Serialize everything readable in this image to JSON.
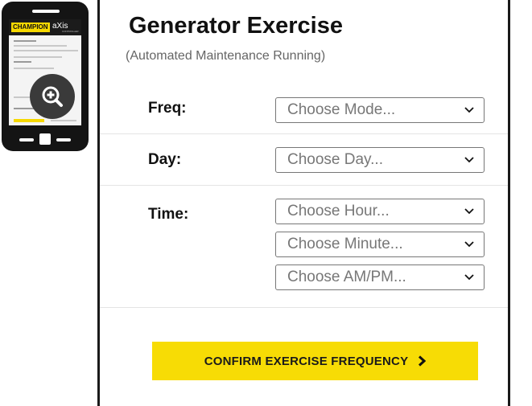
{
  "page": {
    "title": "Generator Exercise",
    "subtitle": "(Automated Maintenance Running)"
  },
  "thumbnail": {
    "brand": "CHAMPION",
    "product": "aXis",
    "product_sub": "CONTROLLER",
    "icon": "zoom-in-icon"
  },
  "fields": {
    "freq": {
      "label": "Freq:",
      "value": "Choose Mode..."
    },
    "day": {
      "label": "Day:",
      "value": "Choose Day..."
    },
    "time": {
      "label": "Time:",
      "hour": "Choose Hour...",
      "minute": "Choose Minute...",
      "ampm": "Choose AM/PM..."
    }
  },
  "confirm_button": {
    "label": "CONFIRM EXERCISE FREQUENCY",
    "icon": "chevron-right-icon"
  },
  "colors": {
    "accent_yellow": "#f7dc05",
    "phone_body": "#141414",
    "select_border": "#777777",
    "placeholder_text": "#777777"
  }
}
